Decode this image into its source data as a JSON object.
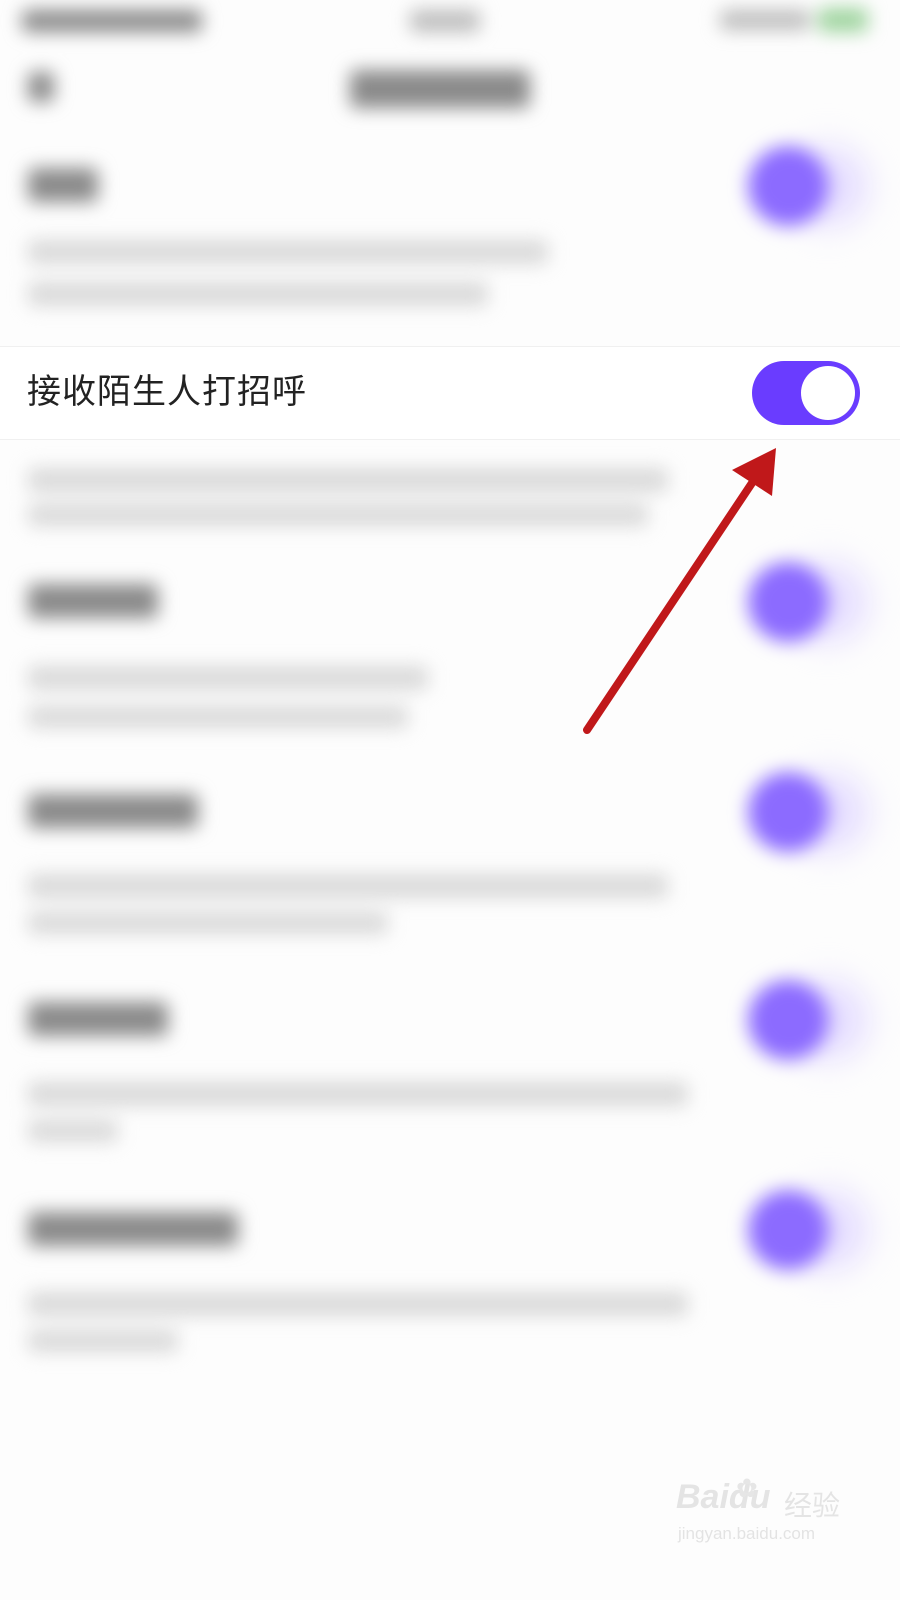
{
  "setting_row": {
    "label": "接收陌生人打招呼",
    "toggle_on": true,
    "accent_color": "#6a3cff"
  },
  "annotation": {
    "arrow_color": "#c0181a"
  },
  "watermark": {
    "brand": "Bai",
    "brand_tail": "du",
    "cn": "经验",
    "url": "jingyan.baidu.com"
  }
}
